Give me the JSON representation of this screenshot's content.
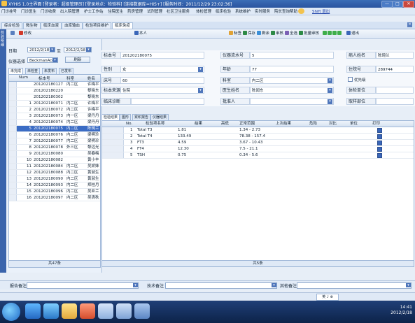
{
  "window": {
    "title": "XYHIS 1.0主界面 [登录者：超级管理员] [登录地点：检验科] [连接数据库=HIS+] [服务时间：2011/12/29 23:02:36]",
    "min": "—",
    "max": "□",
    "close": "✕"
  },
  "menu": [
    "门诊挂号",
    "门诊医生",
    "门诊收费",
    "出入院管理",
    "护士工作站",
    "住院医生",
    "药房管理",
    "试剂管理",
    "社区卫生服务",
    "体检管理",
    "临床检验",
    "系统维护",
    "实时服务",
    "院长查询",
    "帮助",
    "Shift 退出"
  ],
  "tabs": {
    "items": [
      "综合检验",
      "微生物",
      "临床血液",
      "血库输血",
      "检验项目维护",
      "临床免疫"
    ],
    "active": 5,
    "close": "✕"
  },
  "sidebar_label": "检验明细",
  "toolbar": {
    "left": [
      "修改"
    ],
    "right": [
      "本人",
      "标签",
      "保存",
      "剩余",
      "审核",
      "全选",
      "批量审核",
      "退出"
    ]
  },
  "left_pane": {
    "date_label": "日期",
    "date_from": "2012/2/18",
    "to_label": "至",
    "date_to": "2012/2/18",
    "instrument_label": "仪器选择",
    "instrument_value": "BeckmanAcce",
    "refresh_button": "刷新",
    "subtabs": [
      "未完成",
      "未检查",
      "未发布",
      "已发布"
    ],
    "columns": [
      "Num",
      "标本号",
      "科室",
      "姓名"
    ],
    "rows": [
      {
        "num": "",
        "id": "201202180127",
        "dept": "内二区",
        "name": "许梅平"
      },
      {
        "num": "",
        "id": "201202180220",
        "dept": "",
        "name": "黎晓东"
      },
      {
        "num": "",
        "id": "201202180302",
        "dept": "",
        "name": "黎晓东"
      },
      {
        "num": "1",
        "id": "201202180071",
        "dept": "内二区",
        "name": "许梅平"
      },
      {
        "num": "2",
        "id": "201202180072",
        "dept": "内二区",
        "name": "许梅平"
      },
      {
        "num": "3",
        "id": "201202180073",
        "dept": "内一区",
        "name": "梁丹丹"
      },
      {
        "num": "4",
        "id": "201202180074",
        "dept": "内二区",
        "name": "梁丹丹"
      },
      {
        "num": "5",
        "id": "201202180075",
        "dept": "内二区",
        "name": "陈琬兰"
      },
      {
        "num": "6",
        "id": "201202180076",
        "dept": "内二区",
        "name": "梁明珍"
      },
      {
        "num": "7",
        "id": "201202180077",
        "dept": "内二区",
        "name": "梁明珍"
      },
      {
        "num": "8",
        "id": "201202180078",
        "dept": "外三区",
        "name": "黎远光"
      },
      {
        "num": "9",
        "id": "201202180080",
        "dept": "",
        "name": "吴春梅"
      },
      {
        "num": "10",
        "id": "201202180082",
        "dept": "",
        "name": "黄小丰"
      },
      {
        "num": "11",
        "id": "201202180084",
        "dept": "内二区",
        "name": "吴娇妹"
      },
      {
        "num": "12",
        "id": "201202180088",
        "dept": "内二区",
        "name": "黄淑生"
      },
      {
        "num": "13",
        "id": "201202180090",
        "dept": "内二区",
        "name": "黄淑生"
      },
      {
        "num": "14",
        "id": "201202180093",
        "dept": "内二区",
        "name": "郑桂月"
      },
      {
        "num": "15",
        "id": "201202180096",
        "dept": "内二区",
        "name": "吴亚兰"
      },
      {
        "num": "16",
        "id": "201202180097",
        "dept": "内二区",
        "name": "吴清秋"
      }
    ],
    "selected_index": 7,
    "footer": "共47条"
  },
  "form": {
    "specimen_no_label": "标本号",
    "specimen_no": "201202180075",
    "sample_seq_label": "仪器流水号",
    "sample_seq": "5",
    "patient_name_label": "病人姓名",
    "patient_name": "陈琬兰",
    "sex_label": "性别",
    "sex": "女",
    "age_label": "年龄",
    "age": "77",
    "admission_no_label": "住院号",
    "admission_no": "289744",
    "bed_label": "床号",
    "bed": "60",
    "dept_label": "科室",
    "dept": "内二区",
    "priority_label": "优先级",
    "source_label": "标本来源",
    "source": "住院",
    "doctor_label": "医生姓名",
    "doctor": "陈闻东",
    "exam_unit_label": "体检单位",
    "diagnosis_label": "临床诊断",
    "approver_label": "批准人",
    "collect_dept_label": "取样部位"
  },
  "result_tabs": [
    "检验结果",
    "图形",
    "累积报告",
    "仪器结果"
  ],
  "result_columns": [
    "No.",
    "检验项名称",
    "结果",
    "高低",
    "正常范围",
    "上次结果",
    "危险",
    "对比",
    "单位",
    "打印"
  ],
  "results": [
    {
      "no": "1",
      "name": "Total T3",
      "value": "1.81",
      "flag": "",
      "range": "1.34 - 2.73"
    },
    {
      "no": "2",
      "name": "Total T4",
      "value": "133.49",
      "flag": "",
      "range": "78.38 - 157.4"
    },
    {
      "no": "3",
      "name": "FT3",
      "value": "4.59",
      "flag": "",
      "range": "3.67 - 10.43"
    },
    {
      "no": "4",
      "name": "FT4",
      "value": "12.30",
      "flag": "",
      "range": "7.5 - 21.1"
    },
    {
      "no": "5",
      "name": "TSH",
      "value": "0.75",
      "flag": "",
      "range": "0.34 - 5.6"
    }
  ],
  "results_footer": "共5条",
  "bottom": {
    "report_note": "报告备注",
    "tech_note": "技术备注",
    "other_note": "其他备注"
  },
  "status": {
    "ime": "英 ♪ ⊕"
  },
  "taskbar": {
    "time": "14:41",
    "date": "2012/2/18"
  },
  "colors": {
    "accent": "#3b6cc4",
    "titlebar": "#2a54a0"
  }
}
